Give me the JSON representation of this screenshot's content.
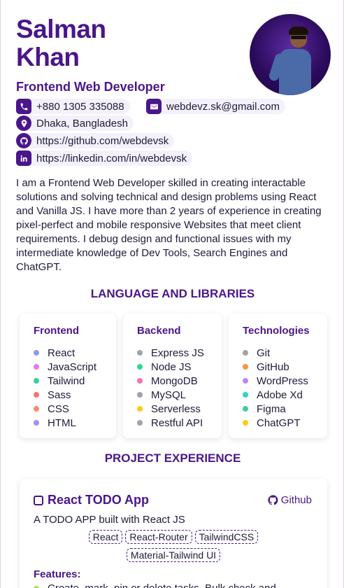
{
  "profile": {
    "first_name": "Salman",
    "last_name": "Khan",
    "role": "Frontend Web Developer",
    "avatar_icon": "profile-photo"
  },
  "contacts": {
    "phone": "+880 1305 335088",
    "email": "webdevz.sk@gmail.com",
    "location": "Dhaka, Bangladesh",
    "github": "https://github.com/webdevsk",
    "linkedin": "https://linkedin.com/in/webdevsk"
  },
  "bio": "I am a Frontend Web Developer skilled in creating interactable solutions and solving technical and design problems using React and Vanilla JS. I have more than 2 years of experience in creating pixel-perfect and mobile responsive Websites that meet client requirements. I debug design and functional issues with my intermediate knowledge of Dev Tools, Search Engines and ChatGPT.",
  "skills": {
    "section_title": "LANGUAGE AND LIBRARIES",
    "columns": [
      {
        "title": "Frontend",
        "items": [
          {
            "label": "React",
            "color": "#8b9cf0"
          },
          {
            "label": "JavaScript",
            "color": "#e879e8"
          },
          {
            "label": "Tailwind",
            "color": "#34d399"
          },
          {
            "label": "Sass",
            "color": "#f87171"
          },
          {
            "label": "CSS",
            "color": "#fb8c6a"
          },
          {
            "label": "HTML",
            "color": "#a78bfa"
          }
        ]
      },
      {
        "title": "Backend",
        "items": [
          {
            "label": "Express JS",
            "color": "#9ca3af"
          },
          {
            "label": "Node JS",
            "color": "#34d399"
          },
          {
            "label": "MongoDB",
            "color": "#f472b6"
          },
          {
            "label": "MySQL",
            "color": "#9ca3af"
          },
          {
            "label": "Serverless",
            "color": "#facc15"
          },
          {
            "label": "Restful API",
            "color": "#9ca3af"
          }
        ]
      },
      {
        "title": "Technologies",
        "items": [
          {
            "label": "Git",
            "color": "#a3a3a3"
          },
          {
            "label": "GitHub",
            "color": "#fb923c"
          },
          {
            "label": "WordPress",
            "color": "#c084fc"
          },
          {
            "label": "Adobe Xd",
            "color": "#2dd4bf"
          },
          {
            "label": "Figma",
            "color": "#34d399"
          },
          {
            "label": "ChatGPT",
            "color": "#facc15"
          }
        ]
      }
    ]
  },
  "projects": {
    "section_title": "PROJECT EXPERIENCE",
    "items": [
      {
        "title": "React TODO App",
        "link_label": "Github",
        "description": "A TODO APP built with React JS",
        "tags": [
          "React",
          "React-Router",
          "TailwindCSS",
          "Material-Tailwind UI"
        ],
        "features_label": "Features:",
        "features": [
          "Create, mark, pin or delete tasks. Bulk check and"
        ]
      }
    ]
  },
  "colors": {
    "accent": "#4a168a",
    "contact_bg": "#f4f1fb"
  }
}
